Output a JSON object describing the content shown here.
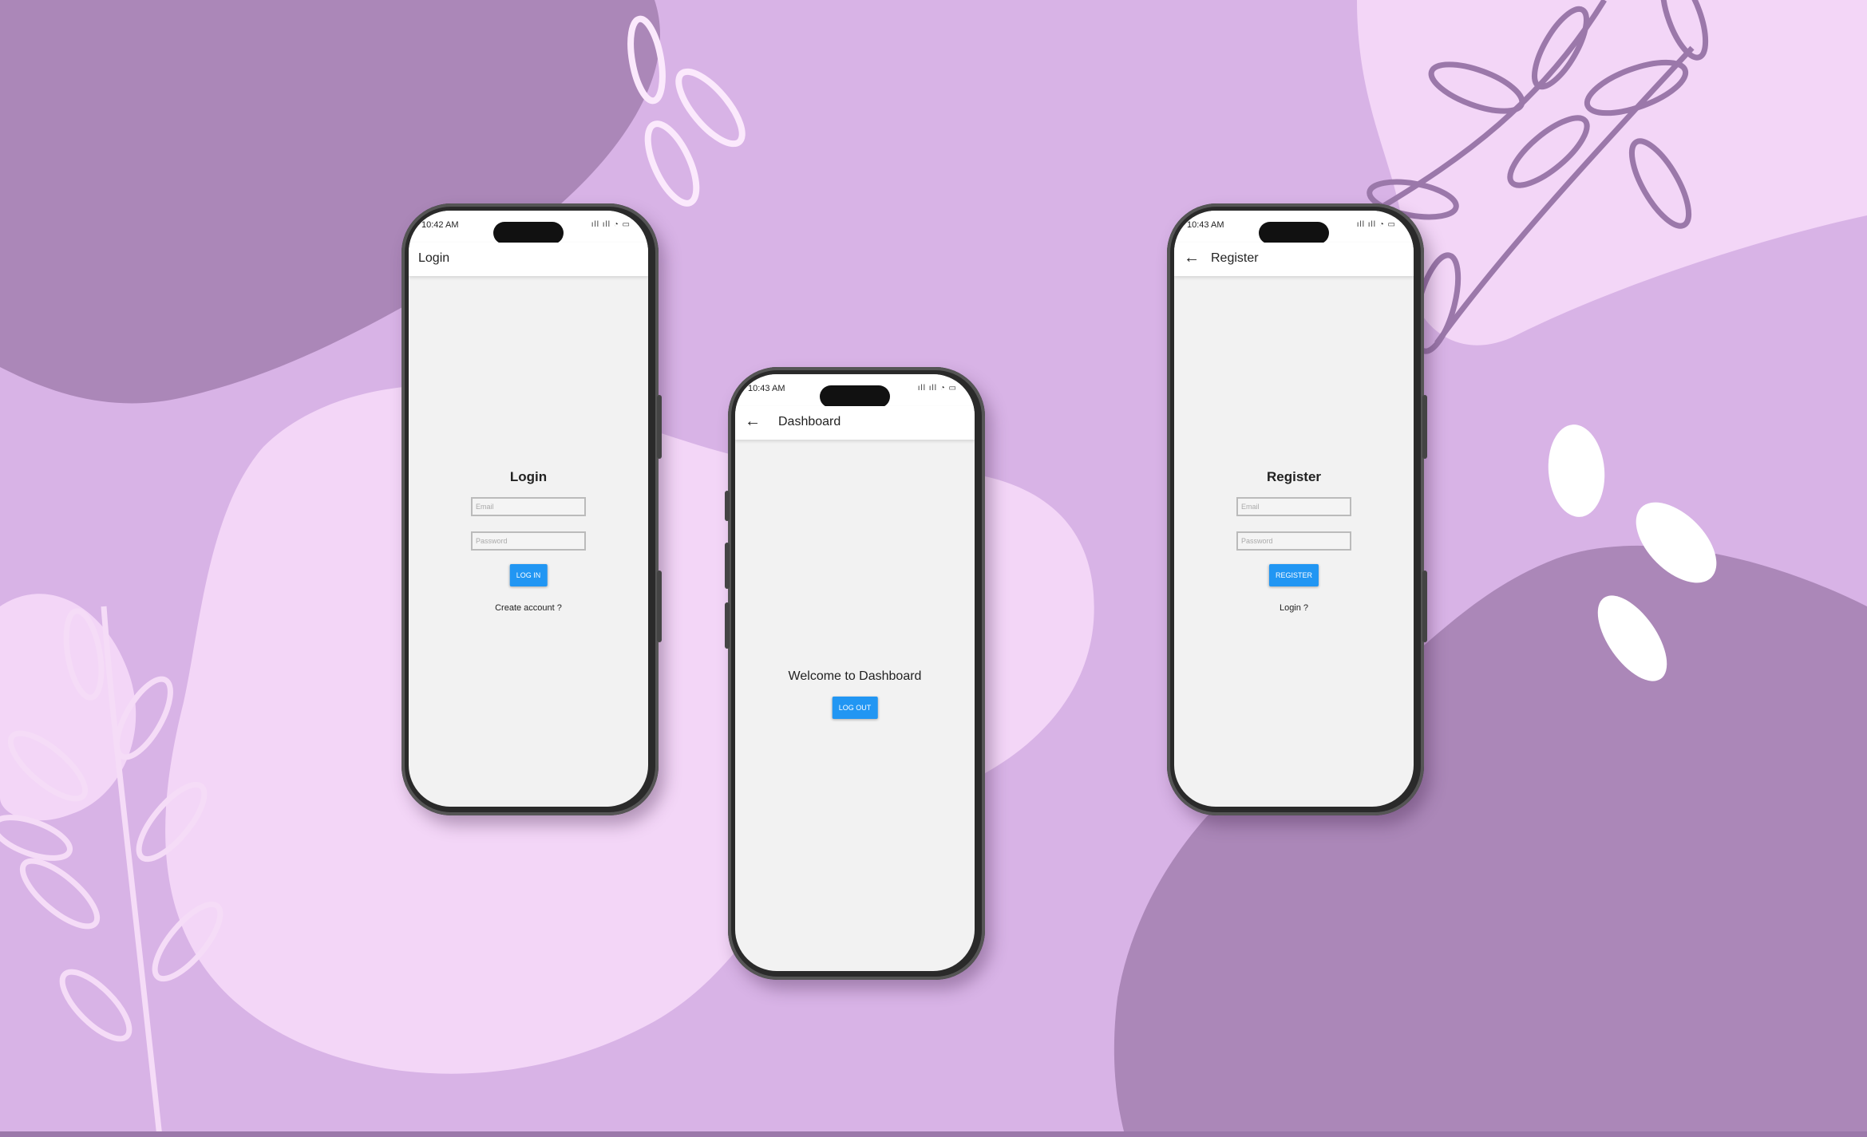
{
  "colors": {
    "background": "#d8b3e6",
    "accent_button": "#2196f3"
  },
  "phones": {
    "login": {
      "status_time": "10:42 AM",
      "status_icons": "ıll ıll ◔ ▭",
      "appbar_title": "Login",
      "heading": "Login",
      "email_placeholder": "Email",
      "password_placeholder": "Password",
      "button_label": "LOG IN",
      "link_text": "Create account ?"
    },
    "dashboard": {
      "status_time": "10:43 AM",
      "status_icons": "ıll ıll ◔ ▭",
      "back_icon": "arrow-left-icon",
      "appbar_title": "Dashboard",
      "welcome_text": "Welcome to Dashboard",
      "button_label": "LOG OUT"
    },
    "register": {
      "status_time": "10:43 AM",
      "status_icons": "ıll ıll ◔ ▭",
      "back_icon": "arrow-left-icon",
      "appbar_title": "Register",
      "heading": "Register",
      "email_placeholder": "Email",
      "password_placeholder": "Password",
      "button_label": "REGISTER",
      "link_text": "Login ?"
    }
  }
}
